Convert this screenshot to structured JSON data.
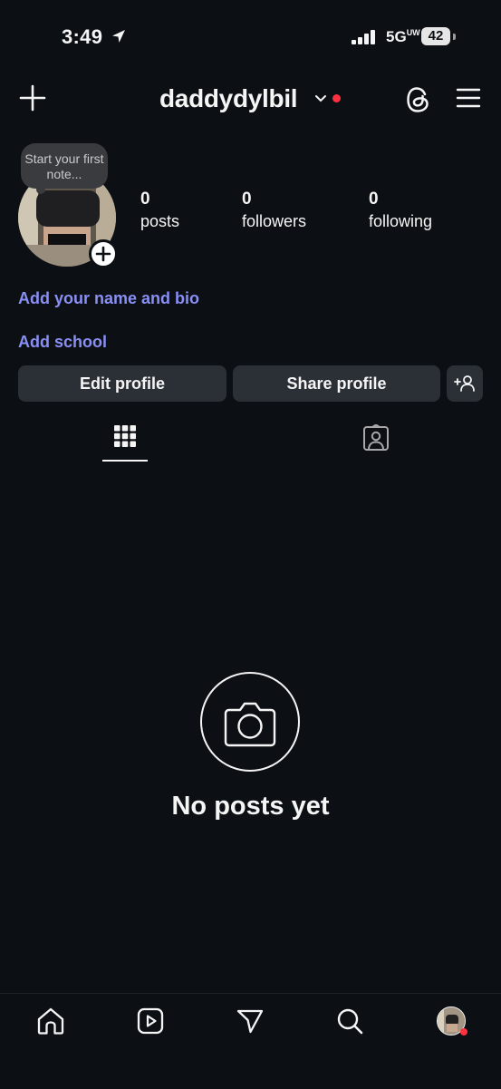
{
  "status_bar": {
    "time": "3:49",
    "network": "5G",
    "network_suffix": "UW",
    "battery": "42"
  },
  "header": {
    "username": "daddydylbil",
    "icons": [
      "plus-icon",
      "chevron-down-icon",
      "threads-icon",
      "menu-icon"
    ]
  },
  "note": {
    "text": "Start your first note..."
  },
  "stats": {
    "posts": {
      "count": "0",
      "label": "posts"
    },
    "followers": {
      "count": "0",
      "label": "followers"
    },
    "following": {
      "count": "0",
      "label": "following"
    }
  },
  "profile_links": {
    "bio": "Add your name and bio",
    "school": "Add school"
  },
  "buttons": {
    "edit": "Edit profile",
    "share": "Share profile",
    "discover_icon": "add-person-icon"
  },
  "tabs": [
    {
      "icon": "grid-icon",
      "active": true
    },
    {
      "icon": "tagged-icon",
      "active": false
    }
  ],
  "empty_state": {
    "icon": "camera-icon",
    "title": "No posts yet"
  },
  "bottom_nav": [
    "home-icon",
    "reels-icon",
    "send-icon",
    "search-icon",
    "profile-avatar"
  ],
  "colors": {
    "background": "#0c1014",
    "link": "#8a8ff5",
    "button": "#2b2f36",
    "notification": "#ff3040"
  }
}
